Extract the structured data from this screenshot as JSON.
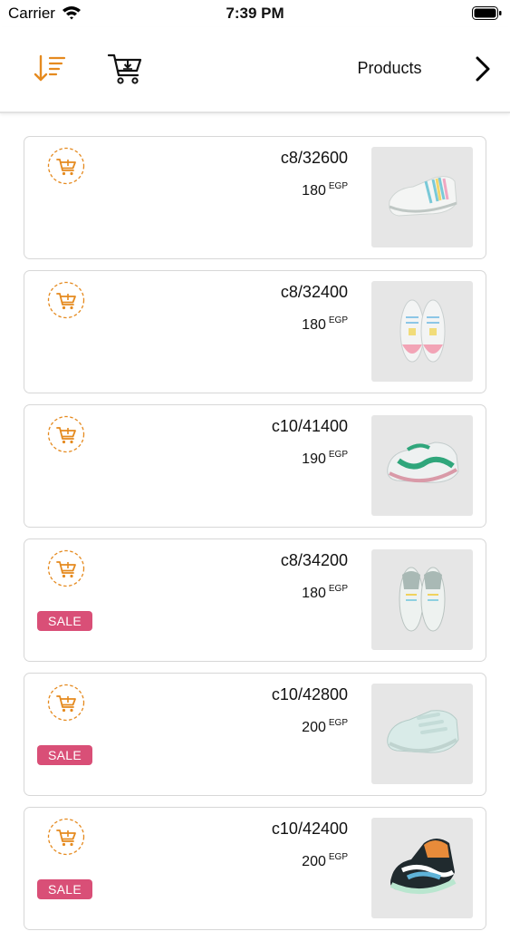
{
  "status_bar": {
    "carrier": "Carrier",
    "time": "7:39 PM"
  },
  "header": {
    "title": "Products",
    "sort_icon": "sort-descending-icon",
    "cart_icon": "cart-download-icon",
    "next_icon": "chevron-right-icon"
  },
  "colors": {
    "accent": "#e58a1f",
    "sale": "#d94f77",
    "card_border": "#d7d7d7",
    "thumb_bg": "#e6e6e6"
  },
  "products": [
    {
      "code": "c8/32600",
      "price": "180",
      "currency": "EGP",
      "sale": false,
      "sale_label": ""
    },
    {
      "code": "c8/32400",
      "price": "180",
      "currency": "EGP",
      "sale": false,
      "sale_label": ""
    },
    {
      "code": "c10/41400",
      "price": "190",
      "currency": "EGP",
      "sale": false,
      "sale_label": ""
    },
    {
      "code": "c8/34200",
      "price": "180",
      "currency": "EGP",
      "sale": true,
      "sale_label": "SALE"
    },
    {
      "code": "c10/42800",
      "price": "200",
      "currency": "EGP",
      "sale": true,
      "sale_label": "SALE"
    },
    {
      "code": "c10/42400",
      "price": "200",
      "currency": "EGP",
      "sale": true,
      "sale_label": "SALE"
    }
  ]
}
